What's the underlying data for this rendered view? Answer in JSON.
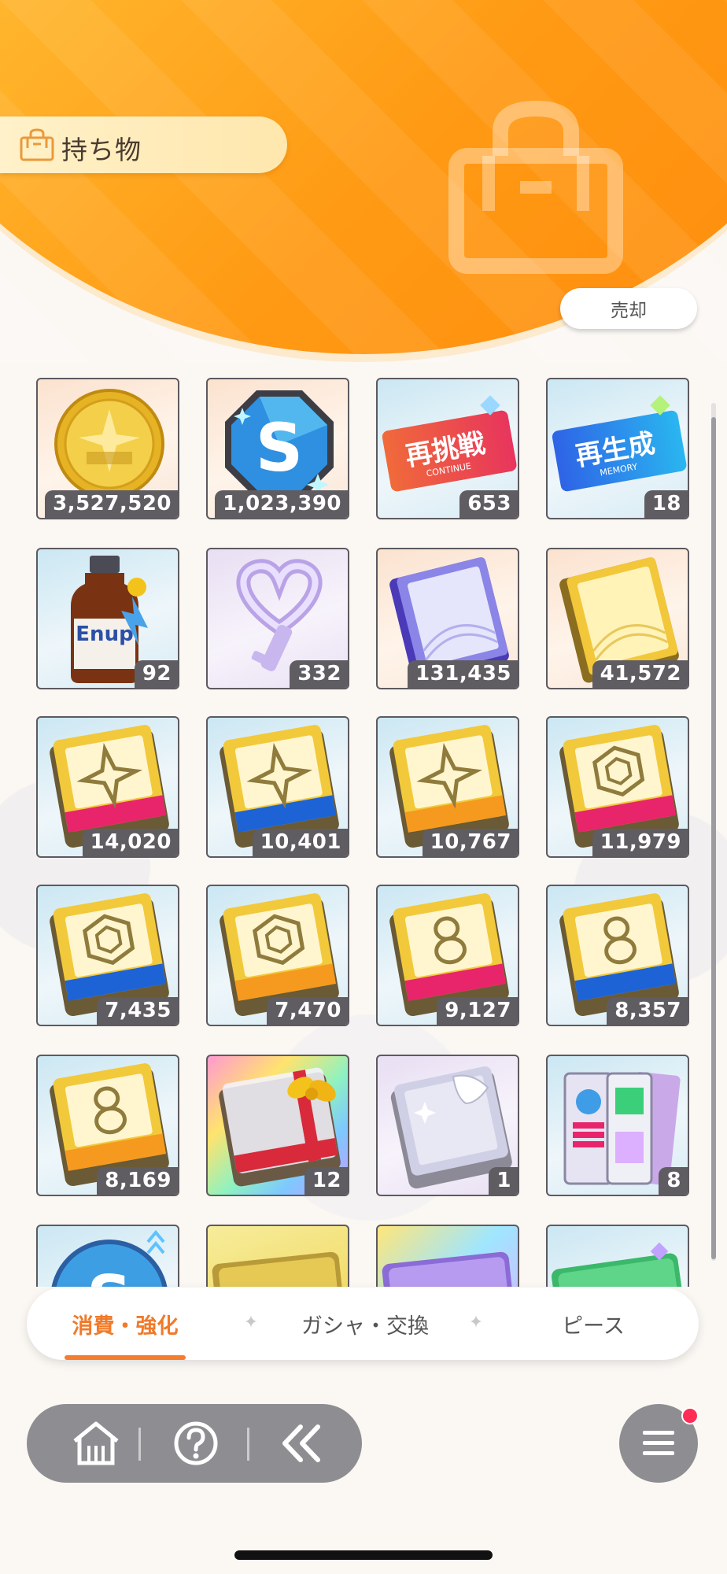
{
  "header": {
    "title": "持ち物",
    "sell_label": "売却",
    "bag_icon": "bag-icon"
  },
  "items": [
    {
      "count": "3,527,520",
      "icon": "gold-coin"
    },
    {
      "count": "1,023,390",
      "icon": "s-gem"
    },
    {
      "count": "653",
      "icon": "retry-ticket",
      "ticket_main": "再挑戦",
      "ticket_sub": "CONTINUE"
    },
    {
      "count": "18",
      "icon": "regen-ticket",
      "ticket_main": "再生成",
      "ticket_sub": "MEMORY"
    },
    {
      "count": "92",
      "icon": "energy-drink",
      "bottle_text": "Enup"
    },
    {
      "count": "332",
      "icon": "heart-key"
    },
    {
      "count": "131,435",
      "icon": "purple-notebook"
    },
    {
      "count": "41,572",
      "icon": "yellow-notebook"
    },
    {
      "count": "14,020",
      "icon": "book-sparkle-pink"
    },
    {
      "count": "10,401",
      "icon": "book-sparkle-blue"
    },
    {
      "count": "10,767",
      "icon": "book-sparkle-orange"
    },
    {
      "count": "11,979",
      "icon": "book-hex-pink"
    },
    {
      "count": "7,435",
      "icon": "book-hex-blue"
    },
    {
      "count": "7,470",
      "icon": "book-hex-orange"
    },
    {
      "count": "9,127",
      "icon": "book-loop-pink"
    },
    {
      "count": "8,357",
      "icon": "book-loop-blue"
    },
    {
      "count": "8,169",
      "icon": "book-loop-orange"
    },
    {
      "count": "12",
      "icon": "rainbow-gift-book"
    },
    {
      "count": "1",
      "icon": "white-costume-book"
    },
    {
      "count": "8",
      "icon": "binder-set"
    },
    {
      "count": "",
      "icon": "partial-s-gem"
    },
    {
      "count": "",
      "icon": "partial-gold-card"
    },
    {
      "count": "",
      "icon": "partial-rainbow-card"
    },
    {
      "count": "",
      "icon": "partial-green-card"
    }
  ],
  "tabs": [
    {
      "label": "消費・強化",
      "active": true
    },
    {
      "label": "ガシャ・交換",
      "active": false
    },
    {
      "label": "ピース",
      "active": false
    }
  ],
  "nav": {
    "home_icon": "home-icon",
    "help_icon": "help-icon",
    "back_icon": "back-icon",
    "menu_icon": "menu-icon"
  },
  "colors": {
    "accent": "#f57d2f",
    "badge": "#5f5c62",
    "header_orange": "#ff9a14"
  }
}
